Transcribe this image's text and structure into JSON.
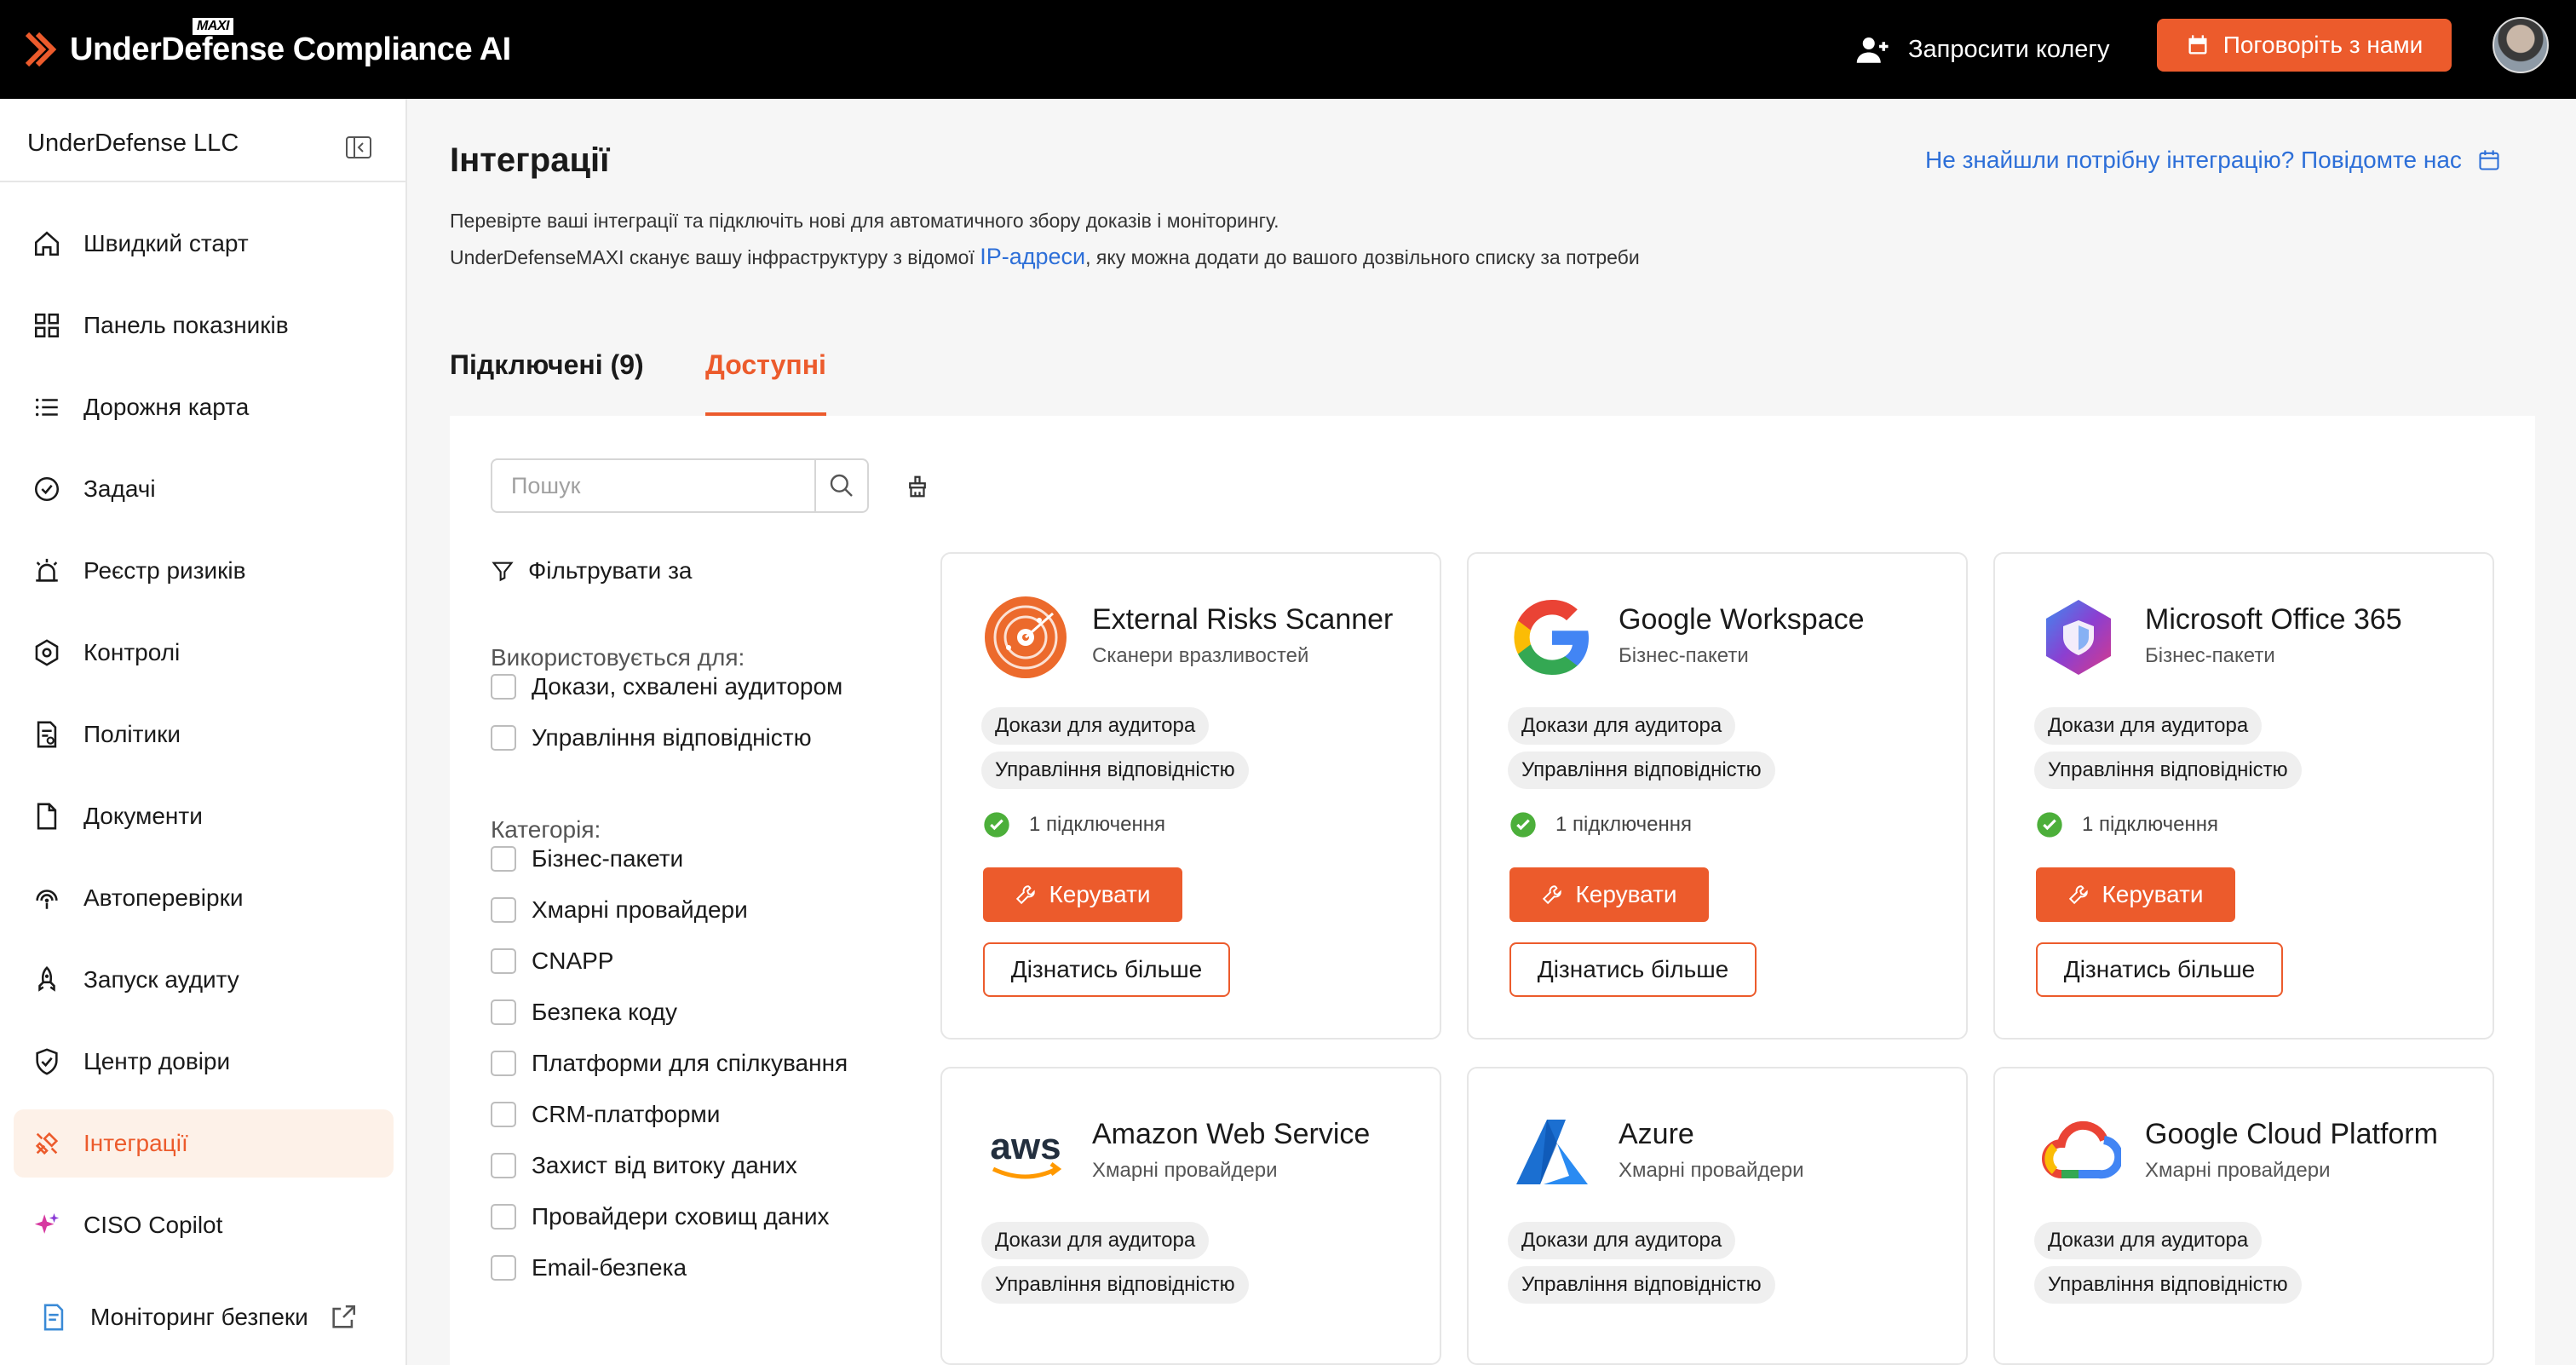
{
  "app": {
    "brand": "UnderDefense Compliance AI",
    "brand_badge": "MAXI",
    "invite_label": "Запросити колегу",
    "talk_label": "Поговоріть з нами",
    "accent_color": "#ec5b2c",
    "link_color": "#2d6fd8"
  },
  "sidebar": {
    "org_name": "UnderDefense LLC",
    "items": [
      {
        "label": "Швидкий старт",
        "icon": "home-icon"
      },
      {
        "label": "Панель показників",
        "icon": "dashboard-grid-icon"
      },
      {
        "label": "Дорожня карта",
        "icon": "list-icon"
      },
      {
        "label": "Задачі",
        "icon": "check-circle-icon"
      },
      {
        "label": "Реєстр ризиків",
        "icon": "alarm-icon"
      },
      {
        "label": "Контролі",
        "icon": "hexagon-icon"
      },
      {
        "label": "Політики",
        "icon": "policy-doc-icon"
      },
      {
        "label": "Документи",
        "icon": "document-icon"
      },
      {
        "label": "Автоперевірки",
        "icon": "radar-icon"
      },
      {
        "label": "Запуск аудиту",
        "icon": "rocket-icon"
      },
      {
        "label": "Центр довіри",
        "icon": "shield-check-icon"
      },
      {
        "label": "Інтеграції",
        "icon": "plug-icon",
        "active": true
      },
      {
        "label": "CISO Copilot",
        "icon": "sparkle-icon"
      },
      {
        "label": "Моніторинг безпеки",
        "icon": "monitor-doc-icon"
      }
    ]
  },
  "page": {
    "title": "Інтеграції",
    "report_link": "Не знайшли потрібну інтеграцію? Повідомте нас",
    "desc_line1": "Перевірте ваші інтеграції та підключіть нові для автоматичного збору доказів і моніторингу.",
    "desc_line2_prefix": "UnderDefenseMAXI сканує вашу інфраструктуру з відомої ",
    "desc_line2_link": "IP-адреси",
    "desc_line2_suffix": ", яку можна додати до вашого дозвільного списку за потреби",
    "tabs": [
      {
        "label": "Підключені (9)",
        "active": false
      },
      {
        "label": "Доступні",
        "active": true
      }
    ]
  },
  "search": {
    "placeholder": "Пошук",
    "value": ""
  },
  "filters": {
    "title": "Фільтрувати за",
    "used_for_label": "Використовується для:",
    "used_for": [
      "Докази, схвалені аудитором",
      "Управління відповідністю"
    ],
    "category_label": "Категорія:",
    "categories": [
      "Бізнес-пакети",
      "Хмарні провайдери",
      "CNAPP",
      "Безпека коду",
      "Платформи для спілкування",
      "CRM-платформи",
      "Захист від витоку даних",
      "Провайдери сховищ даних",
      "Email-безпека"
    ]
  },
  "cards": [
    {
      "name": "External Risks Scanner",
      "category": "Сканери вразливостей",
      "logo": "radar-logo-icon",
      "tags": [
        "Докази для аудитора",
        "Управління відповідністю"
      ],
      "status": "1 підключення",
      "manage": "Керувати",
      "more": "Дізнатись більше"
    },
    {
      "name": "Google Workspace",
      "category": "Бізнес-пакети",
      "logo": "google-logo-icon",
      "tags": [
        "Докази для аудитора",
        "Управління відповідністю"
      ],
      "status": "1 підключення",
      "manage": "Керувати",
      "more": "Дізнатись більше"
    },
    {
      "name": "Microsoft Office 365",
      "category": "Бізнес-пакети",
      "logo": "microsoft-365-logo-icon",
      "tags": [
        "Докази для аудитора",
        "Управління відповідністю"
      ],
      "status": "1 підключення",
      "manage": "Керувати",
      "more": "Дізнатись більше"
    },
    {
      "name": "Amazon Web Service",
      "category": "Хмарні провайдери",
      "logo": "aws-logo-icon",
      "logo_text": "aws",
      "tags": [
        "Докази для аудитора",
        "Управління відповідністю"
      ]
    },
    {
      "name": "Azure",
      "category": "Хмарні провайдери",
      "logo": "azure-logo-icon",
      "tags": [
        "Докази для аудитора",
        "Управління відповідністю"
      ]
    },
    {
      "name": "Google Cloud Platform",
      "category": "Хмарні провайдери",
      "logo": "gcp-logo-icon",
      "tags": [
        "Докази для аудитора",
        "Управління відповідністю"
      ]
    }
  ]
}
